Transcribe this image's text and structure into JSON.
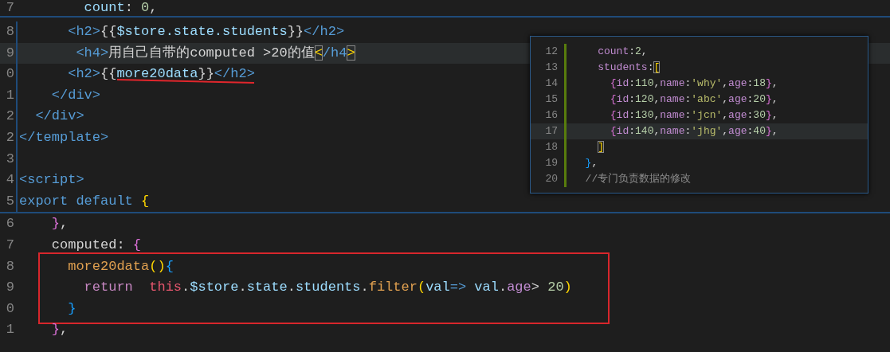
{
  "editor": {
    "sections": [
      {
        "kind": "plain",
        "lines": [
          {
            "number": "7",
            "tokens": [
              {
                "text": "        count",
                "kind": "var"
              },
              {
                "text": ": ",
                "kind": "plain"
              },
              {
                "text": "0",
                "kind": "number"
              },
              {
                "text": ",",
                "kind": "plain"
              }
            ]
          }
        ]
      },
      {
        "kind": "peek",
        "lines": [
          {
            "number": "8",
            "tokens": [
              {
                "text": "      <h2>",
                "kind": "tag"
              },
              {
                "text": "{{",
                "kind": "plain"
              },
              {
                "text": "$store.state.students",
                "kind": "var"
              },
              {
                "text": "}}",
                "kind": "plain"
              },
              {
                "text": "</h2>",
                "kind": "tag"
              }
            ]
          },
          {
            "number": "9",
            "current": true,
            "tokens": [
              {
                "text": "       <h4>",
                "kind": "tag"
              },
              {
                "text": "用自己自带的computed >20的值",
                "kind": "plain"
              },
              {
                "text": "<",
                "kind": "matched"
              },
              {
                "text": "/h4",
                "kind": "tag"
              },
              {
                "text": ">",
                "kind": "matched"
              }
            ]
          },
          {
            "number": "0",
            "tokens": [
              {
                "text": "      <h2>",
                "kind": "tag"
              },
              {
                "text": "{{",
                "kind": "plain"
              },
              {
                "text": "more20data",
                "kind": "var",
                "underlined": true
              },
              {
                "text": "}}",
                "kind": "plain"
              },
              {
                "text": "</h2>",
                "kind": "tag"
              }
            ]
          },
          {
            "number": "1",
            "tokens": [
              {
                "text": "    </div>",
                "kind": "tag"
              }
            ]
          },
          {
            "number": "2",
            "tokens": [
              {
                "text": "  </div>",
                "kind": "tag"
              }
            ]
          },
          {
            "number": "2",
            "tokens": [
              {
                "text": "</template>",
                "kind": "tag"
              }
            ]
          },
          {
            "number": "3"
          },
          {
            "number": "4",
            "tokens": [
              {
                "text": "<script>",
                "kind": "tag"
              }
            ]
          },
          {
            "number": "5",
            "tokens": [
              {
                "text": "export default ",
                "kind": "keyword"
              },
              {
                "text": "{",
                "kind": "brace1"
              }
            ]
          }
        ]
      },
      {
        "kind": "plain",
        "lines": [
          {
            "number": "6",
            "tokens": [
              {
                "text": "    }",
                "kind": "brace2"
              },
              {
                "text": ",",
                "kind": "plain"
              }
            ]
          },
          {
            "number": "7",
            "tokens": [
              {
                "text": "    computed: ",
                "kind": "plain"
              },
              {
                "text": "{",
                "kind": "brace2"
              }
            ]
          }
        ]
      },
      {
        "kind": "boxed",
        "lines": [
          {
            "number": "8",
            "tokens": [
              {
                "text": "      more20data",
                "kind": "func"
              },
              {
                "text": "()",
                "kind": "brace1"
              },
              {
                "text": "{",
                "kind": "brace3"
              }
            ]
          },
          {
            "number": "9",
            "tokens": [
              {
                "text": "        return  ",
                "kind": "control"
              },
              {
                "text": "this",
                "kind": "this"
              },
              {
                "text": ".",
                "kind": "plain"
              },
              {
                "text": "$store",
                "kind": "var"
              },
              {
                "text": ".",
                "kind": "plain"
              },
              {
                "text": "state",
                "kind": "var"
              },
              {
                "text": ".",
                "kind": "plain"
              },
              {
                "text": "students",
                "kind": "var"
              },
              {
                "text": ".",
                "kind": "plain"
              },
              {
                "text": "filter",
                "kind": "func"
              },
              {
                "text": "(",
                "kind": "brace1"
              },
              {
                "text": "val",
                "kind": "var"
              },
              {
                "text": "=> ",
                "kind": "keyword"
              },
              {
                "text": "val",
                "kind": "var"
              },
              {
                "text": ".",
                "kind": "plain"
              },
              {
                "text": "age",
                "kind": "prop"
              },
              {
                "text": "> ",
                "kind": "plain"
              },
              {
                "text": "20",
                "kind": "number"
              },
              {
                "text": ")",
                "kind": "brace1"
              }
            ]
          },
          {
            "number": "0",
            "tokens": [
              {
                "text": "      }",
                "kind": "brace3"
              }
            ]
          }
        ]
      },
      {
        "kind": "plain",
        "lines": [
          {
            "number": "1",
            "tokens": [
              {
                "text": "    }",
                "kind": "brace2"
              },
              {
                "text": ",",
                "kind": "plain"
              }
            ]
          }
        ]
      }
    ]
  },
  "peek_panel": {
    "lines": [
      {
        "number": "12",
        "tokens": [
          {
            "text": "    count",
            "kind": "prop"
          },
          {
            "text": ":",
            "kind": "plain"
          },
          {
            "text": "2",
            "kind": "number"
          },
          {
            "text": ",",
            "kind": "plain"
          }
        ]
      },
      {
        "number": "13",
        "tokens": [
          {
            "text": "    students",
            "kind": "prop"
          },
          {
            "text": ":",
            "kind": "plain"
          },
          {
            "text": "[",
            "kind": "matched"
          }
        ]
      },
      {
        "number": "14",
        "tokens": [
          {
            "text": "      {",
            "kind": "brace2"
          },
          {
            "text": "id",
            "kind": "prop"
          },
          {
            "text": ":",
            "kind": "plain"
          },
          {
            "text": "110",
            "kind": "number"
          },
          {
            "text": ",",
            "kind": "plain"
          },
          {
            "text": "name",
            "kind": "prop"
          },
          {
            "text": ":",
            "kind": "plain"
          },
          {
            "text": "'why'",
            "kind": "string"
          },
          {
            "text": ",",
            "kind": "plain"
          },
          {
            "text": "age",
            "kind": "prop"
          },
          {
            "text": ":",
            "kind": "plain"
          },
          {
            "text": "18",
            "kind": "number"
          },
          {
            "text": "}",
            "kind": "brace2"
          },
          {
            "text": ",",
            "kind": "plain"
          }
        ]
      },
      {
        "number": "15",
        "tokens": [
          {
            "text": "      {",
            "kind": "brace2"
          },
          {
            "text": "id",
            "kind": "prop"
          },
          {
            "text": ":",
            "kind": "plain"
          },
          {
            "text": "120",
            "kind": "number"
          },
          {
            "text": ",",
            "kind": "plain"
          },
          {
            "text": "name",
            "kind": "prop"
          },
          {
            "text": ":",
            "kind": "plain"
          },
          {
            "text": "'abc'",
            "kind": "string"
          },
          {
            "text": ",",
            "kind": "plain"
          },
          {
            "text": "age",
            "kind": "prop"
          },
          {
            "text": ":",
            "kind": "plain"
          },
          {
            "text": "20",
            "kind": "number"
          },
          {
            "text": "}",
            "kind": "brace2"
          },
          {
            "text": ",",
            "kind": "plain"
          }
        ]
      },
      {
        "number": "16",
        "tokens": [
          {
            "text": "      {",
            "kind": "brace2"
          },
          {
            "text": "id",
            "kind": "prop"
          },
          {
            "text": ":",
            "kind": "plain"
          },
          {
            "text": "130",
            "kind": "number"
          },
          {
            "text": ",",
            "kind": "plain"
          },
          {
            "text": "name",
            "kind": "prop"
          },
          {
            "text": ":",
            "kind": "plain"
          },
          {
            "text": "'jcn'",
            "kind": "string"
          },
          {
            "text": ",",
            "kind": "plain"
          },
          {
            "text": "age",
            "kind": "prop"
          },
          {
            "text": ":",
            "kind": "plain"
          },
          {
            "text": "30",
            "kind": "number"
          },
          {
            "text": "}",
            "kind": "brace2"
          },
          {
            "text": ",",
            "kind": "plain"
          }
        ]
      },
      {
        "number": "17",
        "current": true,
        "tokens": [
          {
            "text": "      {",
            "kind": "brace2"
          },
          {
            "text": "id",
            "kind": "prop"
          },
          {
            "text": ":",
            "kind": "plain"
          },
          {
            "text": "140",
            "kind": "number"
          },
          {
            "text": ",",
            "kind": "plain"
          },
          {
            "text": "name",
            "kind": "prop"
          },
          {
            "text": ":",
            "kind": "plain"
          },
          {
            "text": "'jhg'",
            "kind": "string"
          },
          {
            "text": ",",
            "kind": "plain"
          },
          {
            "text": "age",
            "kind": "prop"
          },
          {
            "text": ":",
            "kind": "plain"
          },
          {
            "text": "40",
            "kind": "number"
          },
          {
            "text": "}",
            "kind": "brace2"
          },
          {
            "text": ",",
            "kind": "plain"
          }
        ]
      },
      {
        "number": "18",
        "tokens": [
          {
            "text": "    ]",
            "kind": "matched"
          }
        ]
      },
      {
        "number": "19",
        "tokens": [
          {
            "text": "  }",
            "kind": "brace3"
          },
          {
            "text": ",",
            "kind": "plain"
          }
        ]
      },
      {
        "number": "20",
        "tokens": [
          {
            "text": "  //专门负责数据的修改",
            "kind": "comment"
          }
        ]
      }
    ]
  }
}
